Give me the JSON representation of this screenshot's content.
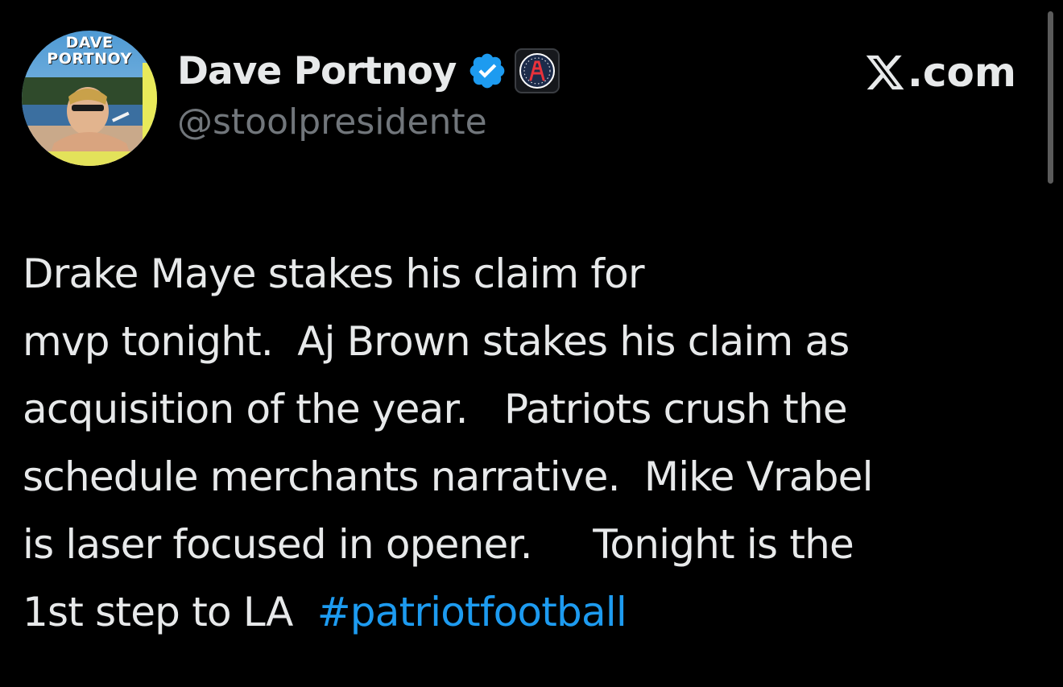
{
  "avatar": {
    "text_line1": "DAVE",
    "text_line2": "PORTNOY"
  },
  "author": {
    "display_name": "Dave Portnoy",
    "handle": "@stoolpresidente",
    "verified_icon": "verified-badge-icon",
    "affiliate_icon": "barstool-affiliate-badge-icon"
  },
  "brand": {
    "logo_icon": "x-logo-icon",
    "text": ".com"
  },
  "tweet": {
    "lines": [
      "Drake Maye stakes his claim for",
      "mvp tonight.  Aj Brown stakes his claim as",
      "acquisition of the year.   Patriots crush the",
      "schedule merchants narrative.  Mike Vrabel",
      "is laser focused in opener.     Tonight is the"
    ],
    "last_line_text": "1st step to LA  ",
    "hashtag": "#patriotfootball"
  },
  "colors": {
    "background": "#000000",
    "text_primary": "#e7e9ea",
    "text_secondary": "#71767b",
    "link": "#1d9bf0",
    "verified": "#1d9bf0"
  }
}
